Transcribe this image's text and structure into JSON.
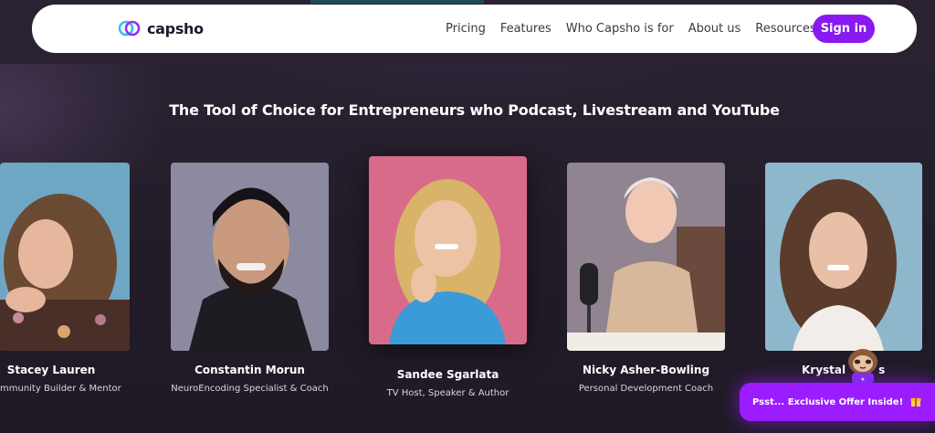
{
  "brand": {
    "name": "capsho",
    "accent": "#8a18f0"
  },
  "nav": {
    "links": [
      "Pricing",
      "Features",
      "Who Capsho is for",
      "About us",
      "Resources"
    ],
    "signin_label": "Sign in"
  },
  "headline": "The Tool of Choice for Entrepreneurs who Podcast, Livestream and YouTube",
  "testimonials": [
    {
      "name": "Stacey Lauren",
      "role": "mmunity Builder & Mentor"
    },
    {
      "name": "Constantin Morun",
      "role": "NeuroEncoding Specialist & Coach"
    },
    {
      "name": "Sandee Sgarlata",
      "role": "TV Host, Speaker & Author"
    },
    {
      "name": "Nicky Asher-Bowling",
      "role": "Personal Development Coach"
    },
    {
      "name": "Krystal",
      "name_suffix": "s"
    }
  ],
  "offer": {
    "label": "Psst... Exclusive Offer Inside!",
    "icon": "gift-icon"
  }
}
